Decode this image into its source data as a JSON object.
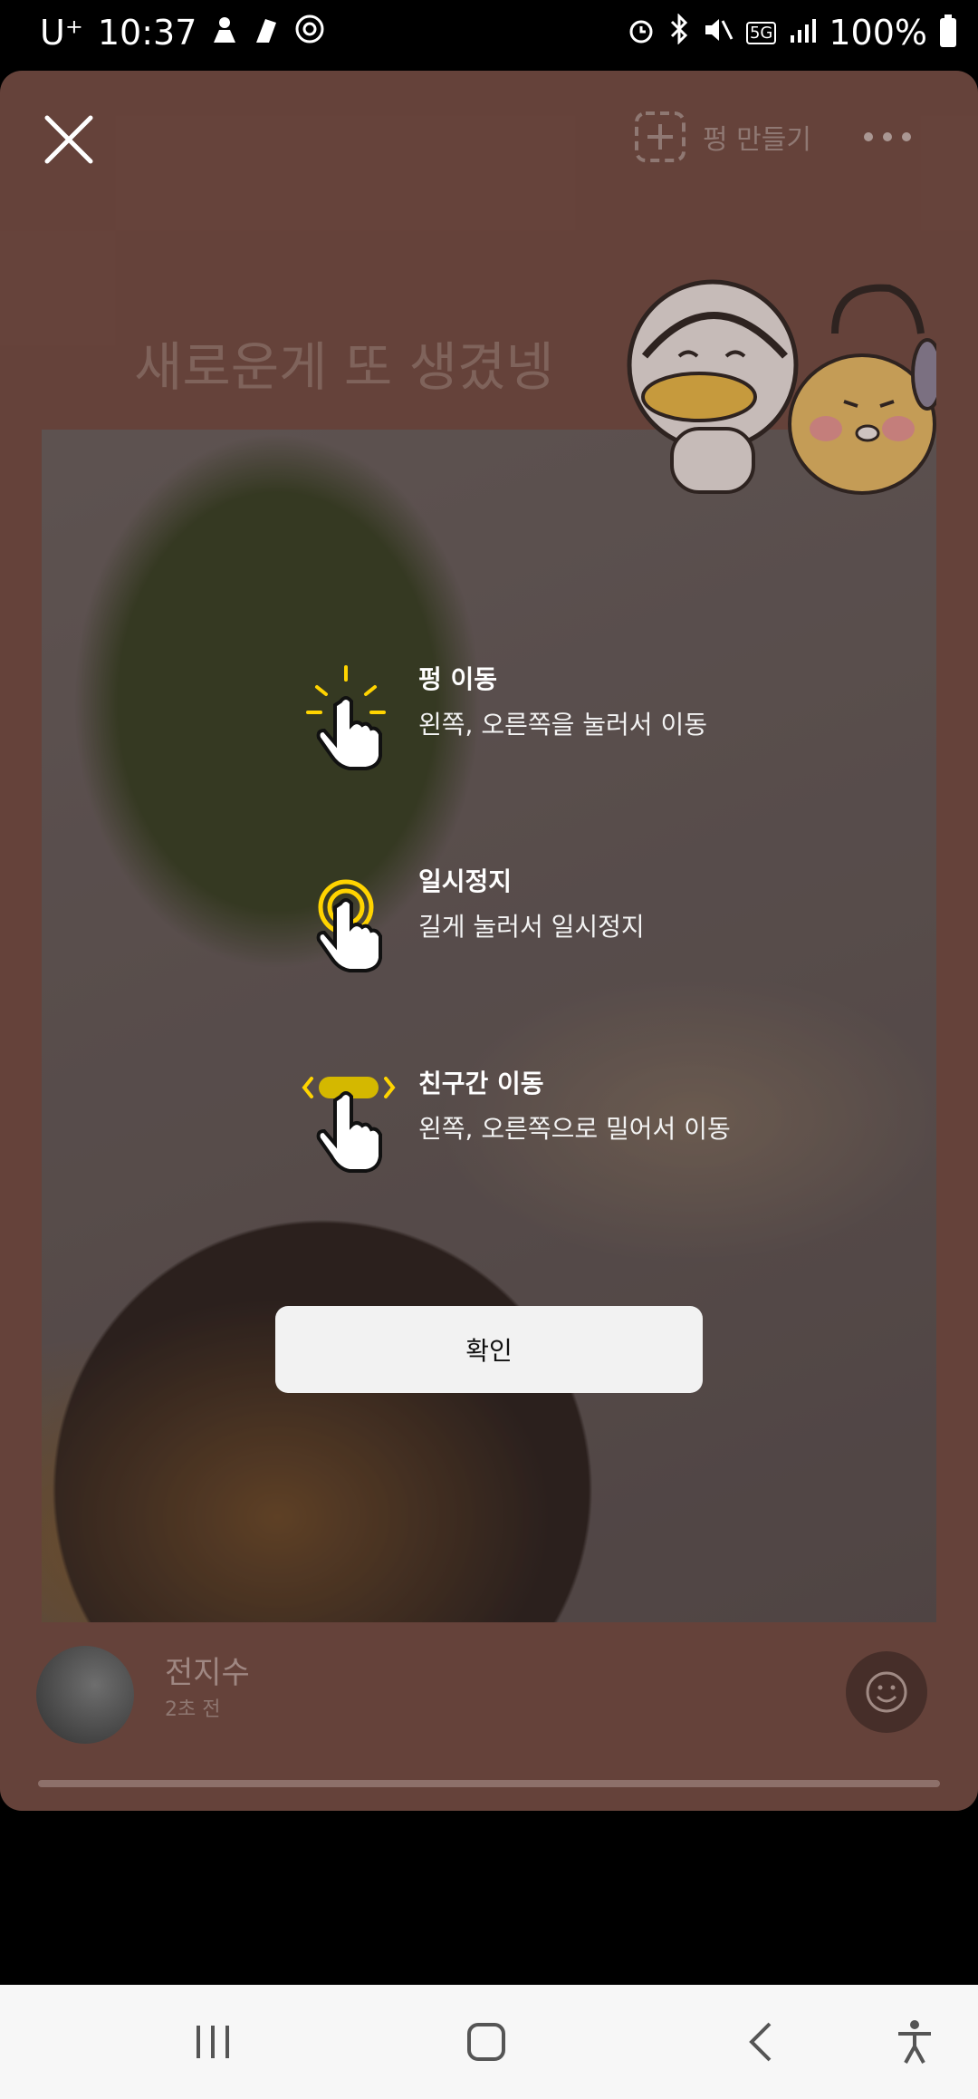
{
  "status_bar": {
    "carrier": "U⁺",
    "time": "10:37",
    "network": "5G",
    "battery": "100%"
  },
  "header": {
    "make_label": "펑 만들기"
  },
  "story": {
    "title": "새로운게 또 생겼넹"
  },
  "guide": {
    "items": [
      {
        "title": "펑 이동",
        "desc": "왼쪽, 오른쪽을 눌러서 이동"
      },
      {
        "title": "일시정지",
        "desc": "길게 눌러서 일시정지"
      },
      {
        "title": "친구간 이동",
        "desc": "왼쪽, 오른쪽으로 밀어서 이동"
      }
    ],
    "confirm_label": "확인"
  },
  "author": {
    "name": "전지수",
    "time": "2초 전"
  },
  "icons": {
    "close": "close-icon",
    "make": "plus-square-icon",
    "more": "more-horizontal-icon",
    "tap": "tap-icon",
    "hold": "press-hold-icon",
    "swipe": "swipe-icon",
    "emoji": "smile-icon"
  },
  "colors": {
    "card_bg": "#6e4d46",
    "guide_accent": "#ffd400"
  }
}
